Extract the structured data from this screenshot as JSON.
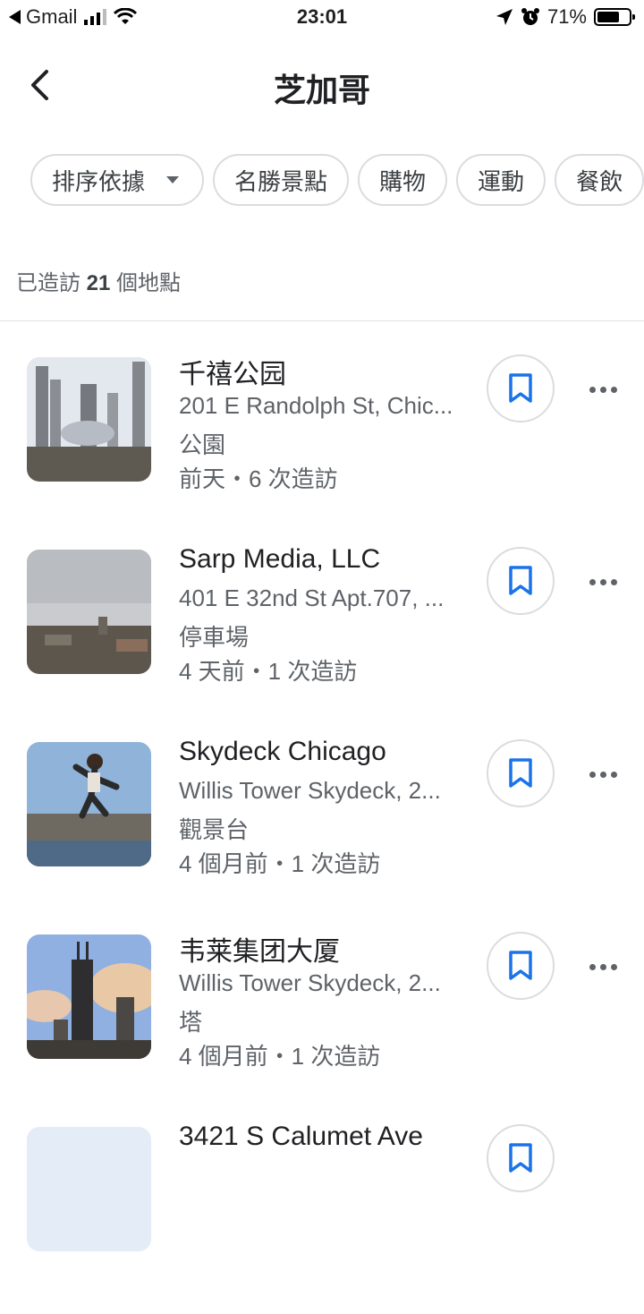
{
  "status_bar": {
    "back_app": "Gmail",
    "time": "23:01",
    "battery": "71%",
    "battery_level": 0.71
  },
  "header": {
    "title": "芝加哥"
  },
  "filters": {
    "sort_label": "排序依據",
    "chips": [
      "名勝景點",
      "購物",
      "運動",
      "餐飲"
    ]
  },
  "summary": {
    "prefix": "已造訪",
    "count": "21",
    "suffix": "個地點"
  },
  "places": [
    {
      "name": "千禧公园",
      "address": "201 E Randolph St, Chic...",
      "category": "公園",
      "visits": "前天・6 次造訪",
      "thumb_colors": [
        "#d9dee6",
        "#6b6b66"
      ]
    },
    {
      "name": "Sarp Media, LLC",
      "address": "401 E 32nd St Apt.707, ...",
      "category": "停車場",
      "visits": "4 天前・1 次造訪",
      "thumb_colors": [
        "#c7c9cc",
        "#5a5249"
      ]
    },
    {
      "name": "Skydeck Chicago",
      "address": "Willis Tower Skydeck, 2...",
      "category": "觀景台",
      "visits": "4 個月前・1 次造訪",
      "thumb_colors": [
        "#8fb3d9",
        "#6e6a62"
      ]
    },
    {
      "name": "韦莱集团大厦",
      "address": "Willis Tower Skydeck, 2...",
      "category": "塔",
      "visits": "4 個月前・1 次造訪",
      "thumb_colors": [
        "#8fb0e0",
        "#e9c9a5"
      ]
    },
    {
      "name": "3421 S Calumet Ave",
      "address": "",
      "category": "",
      "visits": "",
      "thumb_colors": [
        "#e3ecf7",
        "#e3ecf7"
      ]
    }
  ],
  "colors": {
    "accent": "#1a73e8",
    "chip_border": "#dadce0",
    "secondary_text": "#5f6368"
  }
}
